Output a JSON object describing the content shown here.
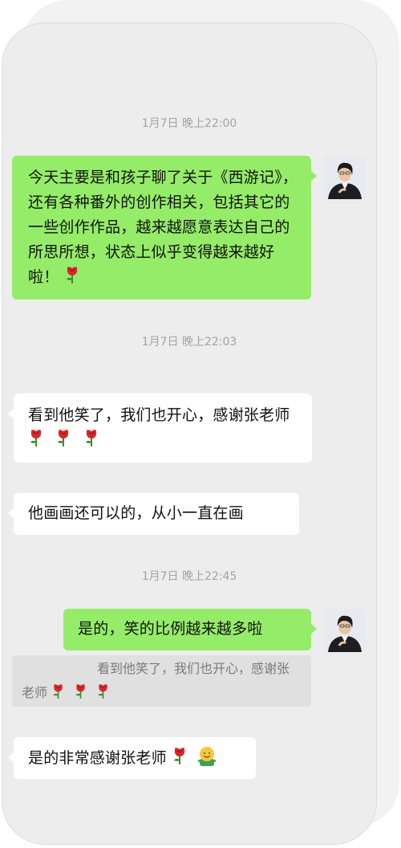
{
  "messages": {
    "ts1": "1月7日 晚上22:00",
    "m1": "今天主要是和孩子聊了关于《西游记》，还有各种番外的创作相关，包括其它的一些创作作品，越来越愿意表达自己的所思所想，状态上似乎变得越来越好啦！",
    "ts2": "1月7日 晚上22:03",
    "m2": "看到他笑了，我们也开心，感谢张老师",
    "m3": "他画画还可以的，从小一直在画",
    "ts3": "1月7日 晚上22:45",
    "m4": "是的，笑的比例越来越多啦",
    "quote": "看到他笑了，我们也开心，感谢张老师",
    "m5": "是的非常感谢张老师"
  },
  "icons": {
    "rose": "rose-emoji-icon",
    "smile": "smiling-face-emoji-icon",
    "avatar": "user-avatar"
  },
  "colors": {
    "chat_background": "#ededed",
    "outgoing_bubble": "#95ec69",
    "incoming_bubble": "#ffffff",
    "timestamp": "#a3a3a3"
  }
}
